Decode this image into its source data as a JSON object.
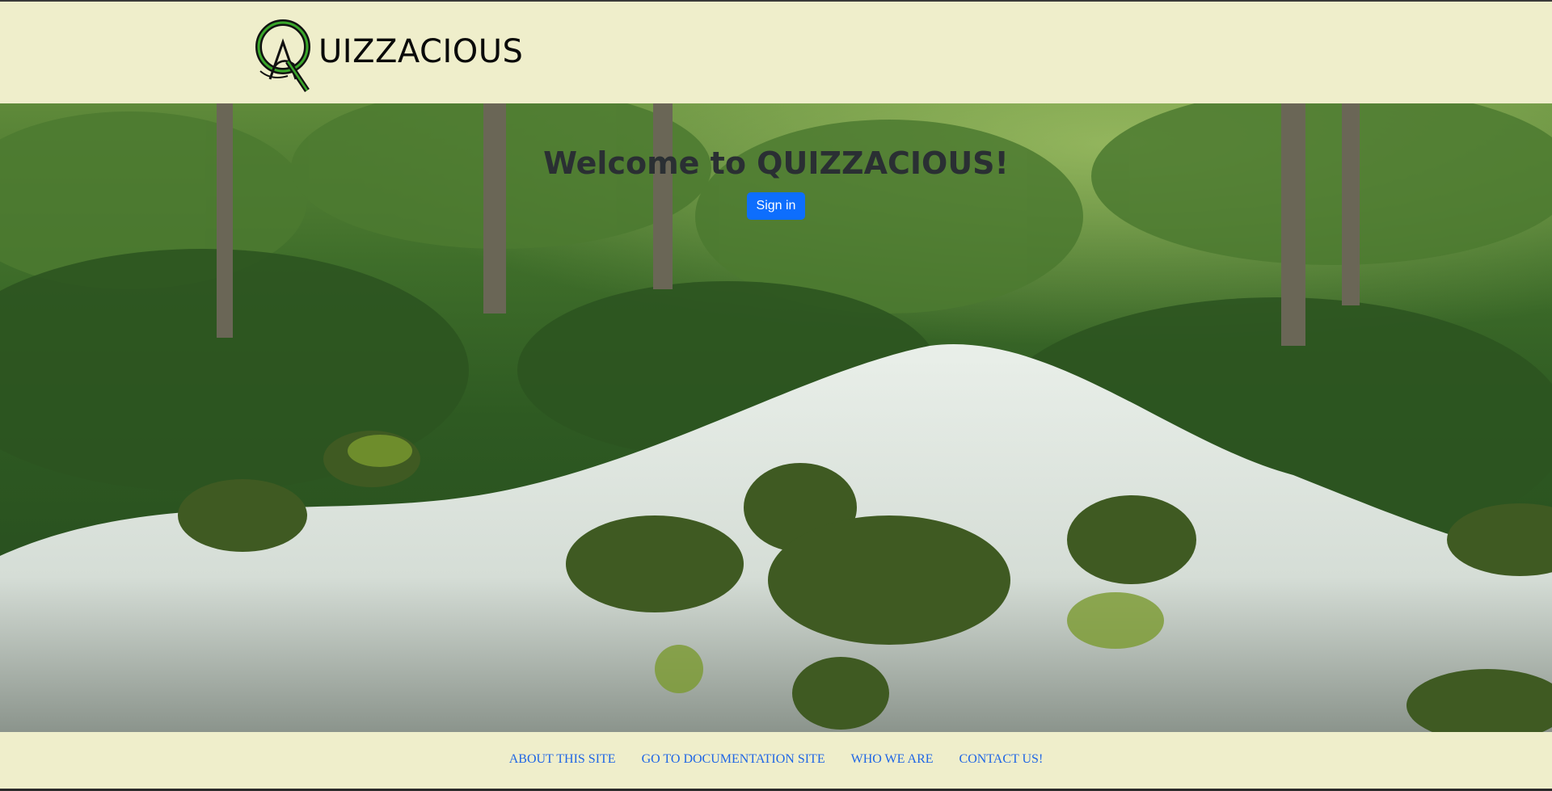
{
  "header": {
    "logo_text": "UIZZACIOUS",
    "logo_full_name": "QUIZZACIOUS",
    "logo_icon": "quizzacious-logo-icon"
  },
  "hero": {
    "title": "Welcome to QUIZZACIOUS!",
    "signin_label": "Sign in",
    "background_image": "forest-stream-photo"
  },
  "footer": {
    "links": [
      {
        "label": "ABOUT THIS SITE"
      },
      {
        "label": "GO TO DOCUMENTATION SITE"
      },
      {
        "label": "WHO WE ARE"
      },
      {
        "label": "CONTACT US!"
      }
    ]
  },
  "colors": {
    "page_background": "#efeecb",
    "primary_button": "#0d6efd",
    "link": "#1f66e5",
    "heading": "#2a2f33",
    "logo_green": "#3aa62a"
  }
}
